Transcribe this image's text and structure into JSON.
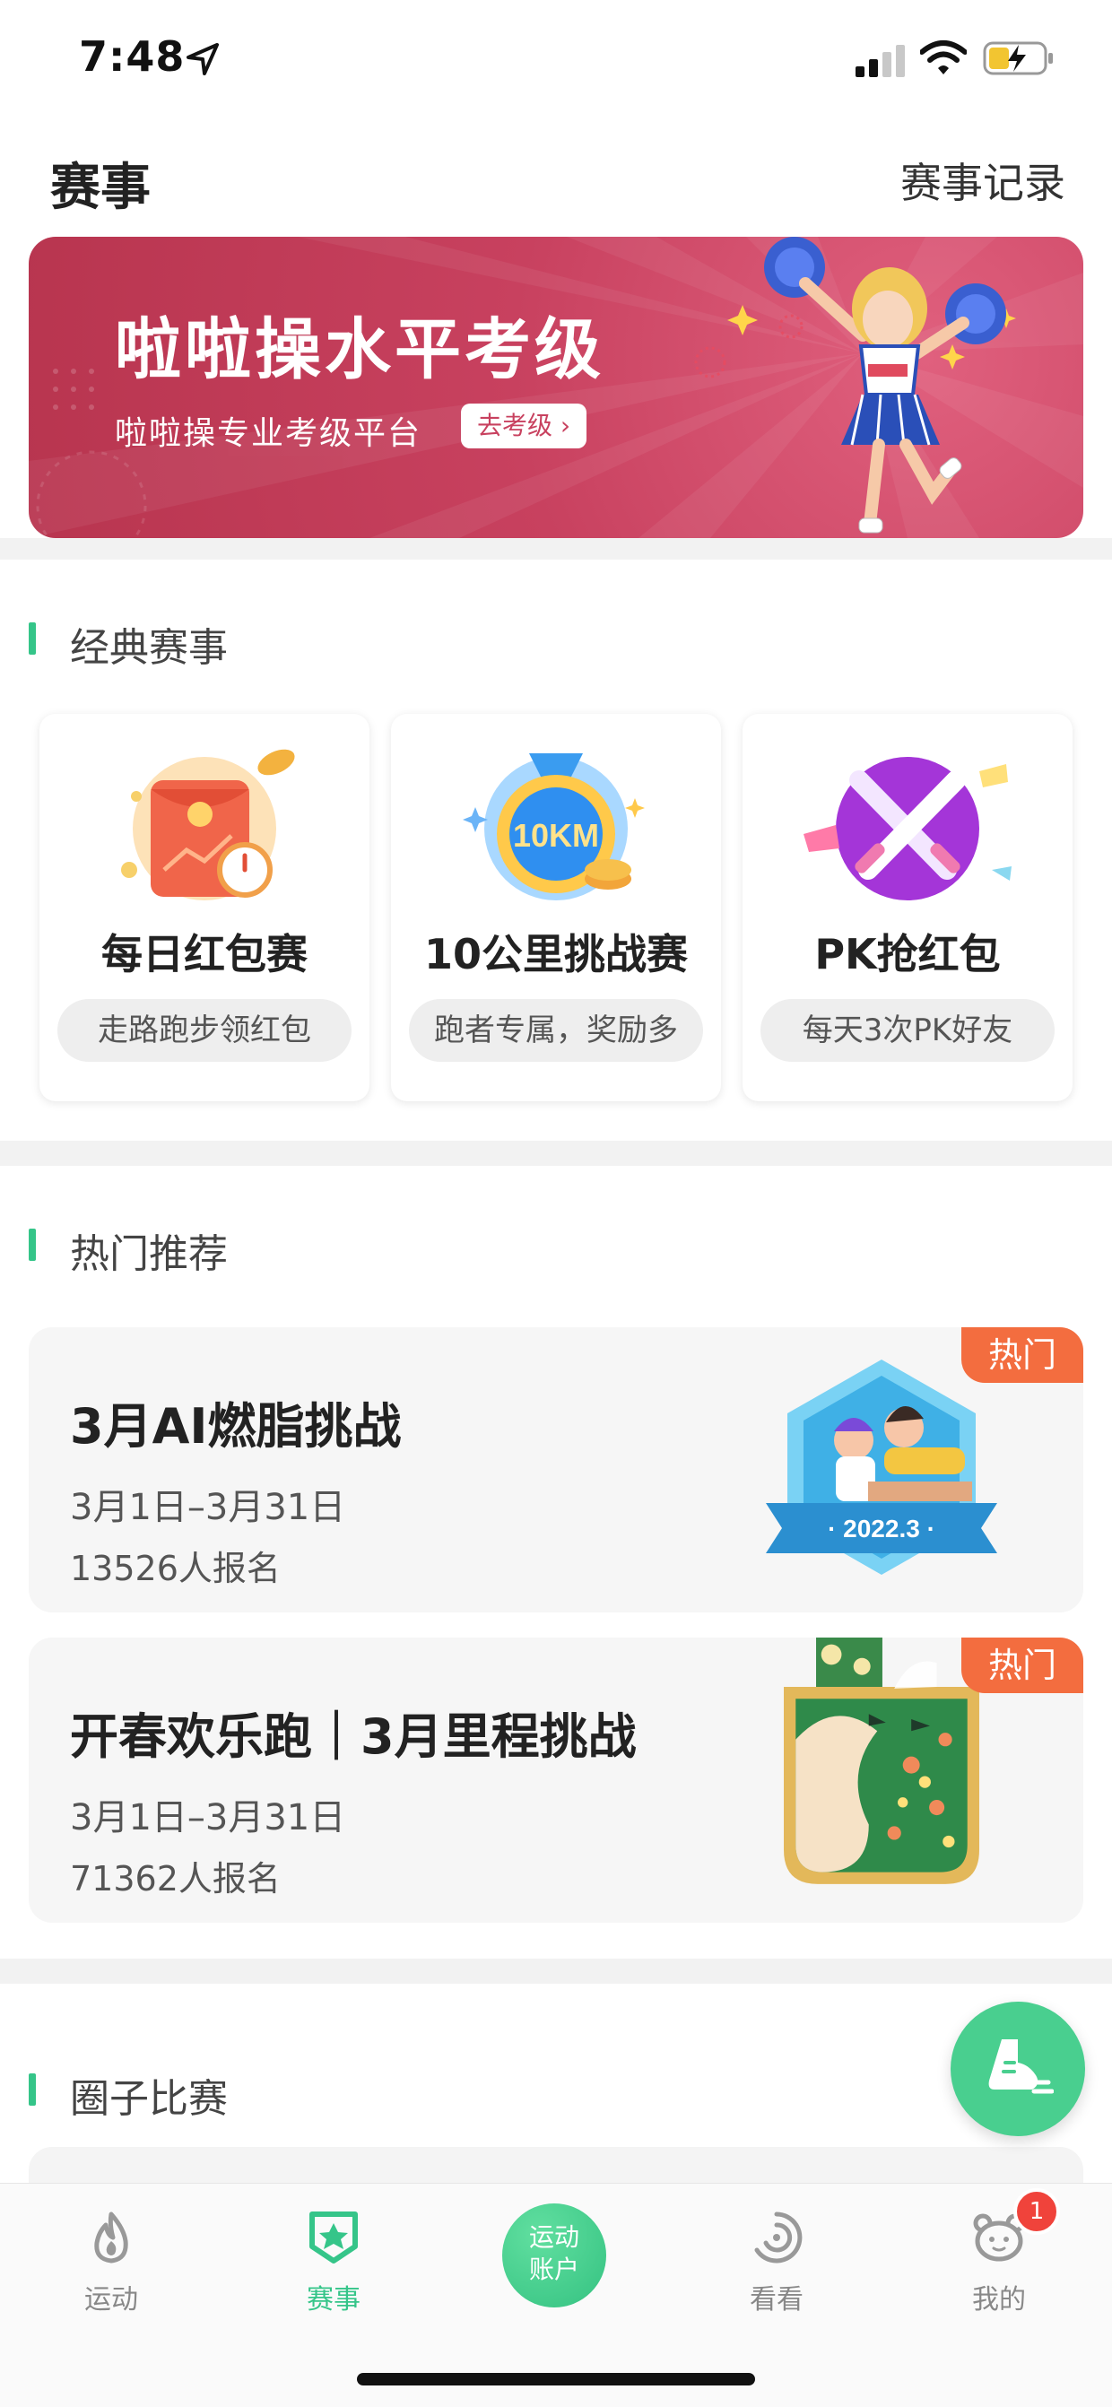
{
  "status_bar": {
    "time": "7:48"
  },
  "header": {
    "title": "赛事",
    "records_link": "赛事记录"
  },
  "banner": {
    "title": "啦啦操水平考级",
    "subtitle": "啦啦操专业考级平台",
    "button_label": "去考级 ›",
    "accent": "#c8415f"
  },
  "classic": {
    "section_title": "经典赛事",
    "cards": [
      {
        "title": "每日红包赛",
        "tag": "走路跑步领红包",
        "icon": "red-envelope-icon"
      },
      {
        "title": "10公里挑战赛",
        "tag": "跑者专属，奖励多",
        "icon": "10km-medal-icon",
        "icon_text": "10KM"
      },
      {
        "title": "PK抢红包",
        "tag": "每天3次PK好友",
        "icon": "crossed-swords-icon"
      }
    ]
  },
  "hot": {
    "section_title": "热门推荐",
    "tag_label": "热门",
    "events": [
      {
        "title": "3月AI燃脂挑战",
        "date": "3月1日–3月31日",
        "count": "13526人报名",
        "medal_text": "· 2022.3 ·"
      },
      {
        "title": "开春欢乐跑｜3月里程挑战",
        "date": "3月1日–3月31日",
        "count": "71362人报名"
      }
    ]
  },
  "circle": {
    "section_title": "圈子比赛"
  },
  "tabbar": {
    "tabs": [
      {
        "label": "运动",
        "icon": "sport-flame-icon"
      },
      {
        "label": "赛事",
        "icon": "event-badge-icon"
      },
      {
        "label": "运动\n账户",
        "line1": "运动",
        "line2": "账户"
      },
      {
        "label": "看看",
        "icon": "look-swirl-icon"
      },
      {
        "label": "我的",
        "icon": "bear-face-icon"
      }
    ],
    "badge_count": "1",
    "active_color": "#35c589"
  }
}
